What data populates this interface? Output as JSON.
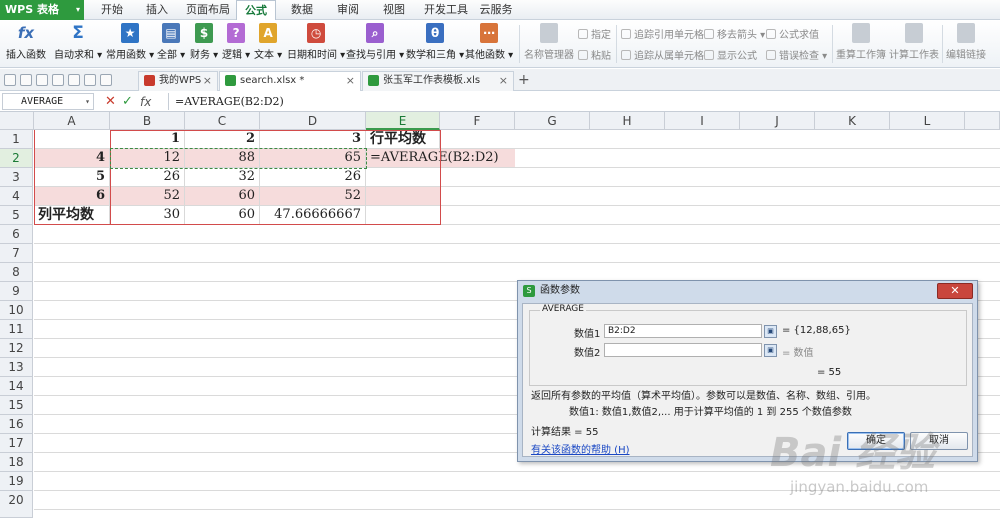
{
  "app": {
    "name": "WPS 表格",
    "drop": "▾"
  },
  "menu_tabs": [
    "开始",
    "插入",
    "页面布局",
    "公式",
    "数据",
    "审阅",
    "视图",
    "开发工具",
    "云服务"
  ],
  "ribbon": {
    "buttons": [
      "插入函数",
      "自动求和",
      "常用函数",
      "全部",
      "财务",
      "逻辑",
      "文本",
      "日期和时间",
      "查找与引用",
      "数学和三角",
      "其他函数"
    ],
    "icon_glyphs": [
      "fx",
      "Σ",
      "★",
      "▤",
      "$",
      "?",
      "A",
      "◷",
      "⌕",
      "θ",
      "⋯"
    ],
    "icon_colors": [
      "#3b6fb6",
      "#2f74c5",
      "#2f74c5",
      "#4a78b9",
      "#3e9a51",
      "#b36bd4",
      "#e0a52c",
      "#cf4b3d",
      "#9a5fcf",
      "#3a6fc0",
      "#d8743a"
    ],
    "group2": {
      "name_mgr": "名称管理器",
      "specify": "指定",
      "paste": "粘贴"
    },
    "audit": {
      "trace_prec": "追踪引用单元格",
      "trace_dep": "追踪从属单元格",
      "remove_arrows": "移去箭头",
      "show_formula": "显示公式",
      "eval": "公式求值",
      "error_check": "错误检查"
    },
    "calc_book": "重算工作簿",
    "calc_sheet": "计算工作表",
    "edit_links": "编辑链接"
  },
  "doc_tabs": [
    {
      "label": "我的WPS",
      "color": "#c83a2c"
    },
    {
      "label": "search.xlsx *",
      "color": "#2f9a3e"
    },
    {
      "label": "张玉军工作表模板.xls",
      "color": "#2f9a3e"
    }
  ],
  "plus": "+",
  "close": "×",
  "formula_bar": {
    "name_box": "AVERAGE",
    "cancel": "✕",
    "accept": "✓",
    "fx": "fx",
    "formula": "=AVERAGE(B2:D2)"
  },
  "columns": [
    "A",
    "B",
    "C",
    "D",
    "E",
    "F",
    "G",
    "H",
    "I",
    "J",
    "K",
    "L"
  ],
  "rows": [
    "1",
    "2",
    "3",
    "4",
    "5",
    "6",
    "7",
    "8",
    "9",
    "10",
    "11",
    "12",
    "13",
    "14",
    "15",
    "16",
    "17",
    "18",
    "19",
    "20"
  ],
  "cells": {
    "B1": "1",
    "C1": "2",
    "D1": "3",
    "E1": "行平均数",
    "A2": "4",
    "B2": "12",
    "C2": "88",
    "D2": "65",
    "E2": "=AVERAGE(B2:D2)",
    "A3": "5",
    "B3": "26",
    "C3": "32",
    "D3": "26",
    "A4": "6",
    "B4": "52",
    "C4": "60",
    "D4": "52",
    "A5": "列平均数",
    "B5": "30",
    "C5": "60",
    "D5": "47.66666667"
  },
  "dialog": {
    "title": "函数参数",
    "close": "✕",
    "func": "AVERAGE",
    "p1_label": "数值1",
    "p1_value": "B2:D2",
    "p1_result": "= {12,88,65}",
    "p2_label": "数值2",
    "p2_value": "",
    "p2_result": "= 数值",
    "result_eq": "= 55",
    "desc": "返回所有参数的平均值（算术平均值）。参数可以是数值、名称、数组、引用。",
    "param_desc": "数值1:  数值1,数值2,...  用于计算平均值的 1 到 255 个数值参数",
    "calc_result": "计算结果 = 55",
    "help": "有关该函数的帮助 (H)",
    "ok": "确定",
    "cancel": "取消"
  },
  "watermark": {
    "main": "Bai 经验",
    "sub": "jingyan.baidu.com"
  }
}
